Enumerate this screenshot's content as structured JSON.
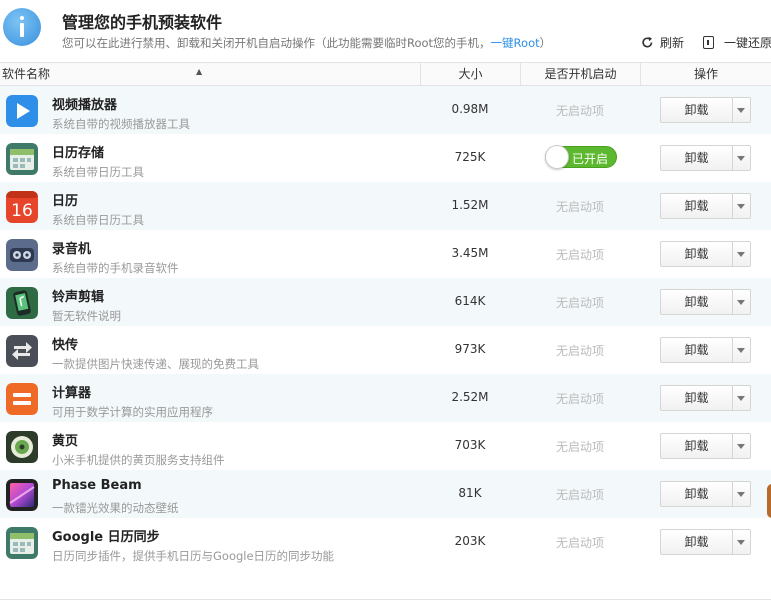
{
  "header": {
    "title": "管理您的手机预装软件",
    "subtitle": "您可以在此进行禁用、卸载和关闭开机自启动操作（此功能需要临时Root您的手机，",
    "subtitle_link": "一键Root",
    "subtitle_end": "）",
    "refresh_label": "刷新",
    "restore_label": "一键还原"
  },
  "table": {
    "columns": {
      "name": "软件名称",
      "sort": "▲",
      "size": "大小",
      "boot": "是否开机启动",
      "op": "操作"
    },
    "rows": [
      {
        "name": "视频播放器",
        "desc": "系统自带的视频播放器工具",
        "size": "0.98M",
        "boot": "无启动项",
        "action": "卸载",
        "icon": "video-player-icon"
      },
      {
        "name": "日历存储",
        "desc": "系统自带日历工具",
        "size": "725K",
        "boot": "已开启",
        "action": "卸载",
        "icon": "calendar-storage-icon"
      },
      {
        "name": "日历",
        "desc": "系统自带日历工具",
        "size": "1.52M",
        "boot": "无启动项",
        "action": "卸载",
        "icon": "calendar-icon",
        "icon_text": "16"
      },
      {
        "name": "录音机",
        "desc": "系统自带的手机录音软件",
        "size": "3.45M",
        "boot": "无启动项",
        "action": "卸载",
        "icon": "recorder-icon"
      },
      {
        "name": "铃声剪辑",
        "desc": "暂无软件说明",
        "size": "614K",
        "boot": "无启动项",
        "action": "卸载",
        "icon": "ringtone-icon"
      },
      {
        "name": "快传",
        "desc": "一款提供图片快速传递、展现的免费工具",
        "size": "973K",
        "boot": "无启动项",
        "action": "卸载",
        "icon": "transfer-icon"
      },
      {
        "name": "计算器",
        "desc": "可用于数学计算的实用应用程序",
        "size": "2.52M",
        "boot": "无启动项",
        "action": "卸载",
        "icon": "calculator-icon"
      },
      {
        "name": "黄页",
        "desc": "小米手机提供的黄页服务支持组件",
        "size": "703K",
        "boot": "无启动项",
        "action": "卸载",
        "icon": "yellow-pages-icon"
      },
      {
        "name": "Phase Beam",
        "desc": "一款镭光效果的动态壁纸",
        "size": "81K",
        "boot": "无启动项",
        "action": "卸载",
        "icon": "phase-beam-icon"
      },
      {
        "name": "Google 日历同步",
        "desc": "日历同步插件，提供手机日历与Google日历的同步功能",
        "size": "203K",
        "boot": "无启动项",
        "action": "卸载",
        "icon": "google-calendar-sync-icon"
      }
    ]
  },
  "colors": {
    "accent": "#2d8ee5",
    "toggle_on": "#5cb82e",
    "row_alt": "#f3f8fb",
    "muted": "#bbbbbb"
  }
}
